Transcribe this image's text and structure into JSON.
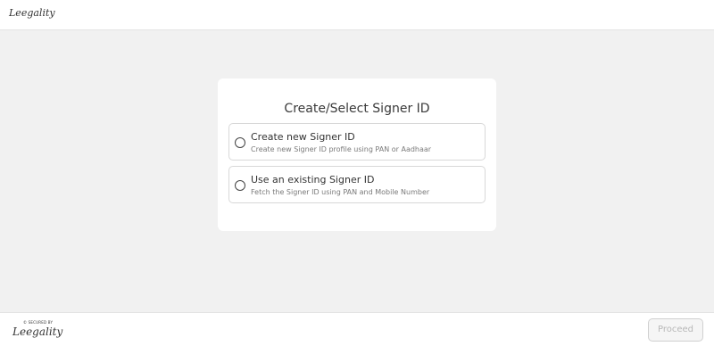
{
  "header": {
    "logo_text": "Leegality"
  },
  "card": {
    "title": "Create/Select Signer ID",
    "options": [
      {
        "title": "Create new Signer ID",
        "subtitle": "Create new Signer ID profile using PAN or Aadhaar",
        "selected": false
      },
      {
        "title": "Use an existing Signer ID",
        "subtitle": "Fetch the Signer ID using PAN and Mobile Number",
        "selected": false
      }
    ]
  },
  "footer": {
    "secured_by": "© SECURED BY",
    "logo_text": "Leegality",
    "proceed_label": "Proceed"
  },
  "colors": {
    "page_bg": "#f1f1f1",
    "card_bg": "#ffffff",
    "disabled_text": "#b8b8b8"
  }
}
